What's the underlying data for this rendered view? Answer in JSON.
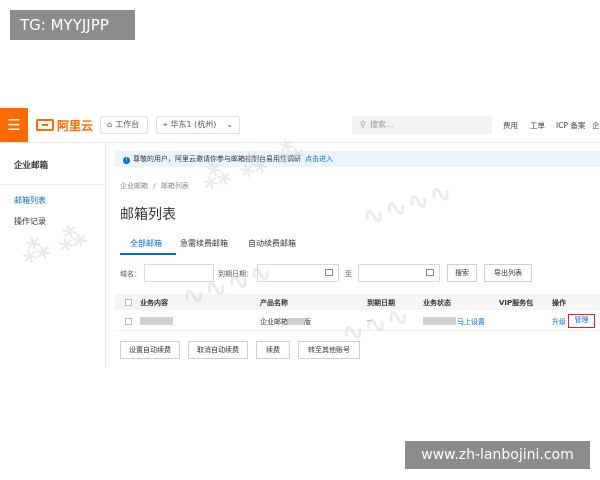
{
  "overlay": {
    "tg_label": "TG: MYYJJPP",
    "site_label": "www.zh-lanbojini.com"
  },
  "topbar": {
    "menu_icon": "hamburger-icon",
    "brand": "阿里云",
    "workbench": "工作台",
    "region": "华东1 (杭州)",
    "search_placeholder": "搜索...",
    "links": [
      "费用",
      "工单",
      "ICP 备案",
      "企"
    ]
  },
  "sidebar": {
    "title": "企业邮箱",
    "items": [
      {
        "label": "邮箱列表",
        "active": true
      },
      {
        "label": "操作记录",
        "active": false
      }
    ]
  },
  "notice": {
    "text": "尊敬的用户，阿里云邀请你参与邮箱控制台易用性调研",
    "link": "点击进入"
  },
  "breadcrumb": {
    "root": "企业邮箱",
    "sep": "/",
    "current": "邮箱列表"
  },
  "page_title": "邮箱列表",
  "tabs": [
    {
      "label": "全部邮箱",
      "active": true
    },
    {
      "label": "急需续费邮箱",
      "active": false
    },
    {
      "label": "自动续费邮箱",
      "active": false
    }
  ],
  "filters": {
    "domain_label": "域名：",
    "expire_label": "到期日期：",
    "to_label": "至",
    "search_button": "搜索",
    "export_button": "导出列表"
  },
  "table": {
    "headers": [
      "业务内容",
      "产品名称",
      "到期日期",
      "业务状态",
      "VIP服务包",
      "操作"
    ],
    "rows": [
      {
        "product": "企业邮箱",
        "product_suffix": "版",
        "expire": "--",
        "status_link": "马上设置",
        "vip": "",
        "upgrade": "升级",
        "manage": "管理"
      }
    ]
  },
  "actions": [
    "设置自动续费",
    "取消自动续费",
    "续费",
    "转至其他账号"
  ],
  "colors": {
    "brand_orange": "#ff6a00",
    "link_blue": "#0070cc",
    "highlight_red": "#d9202a"
  }
}
